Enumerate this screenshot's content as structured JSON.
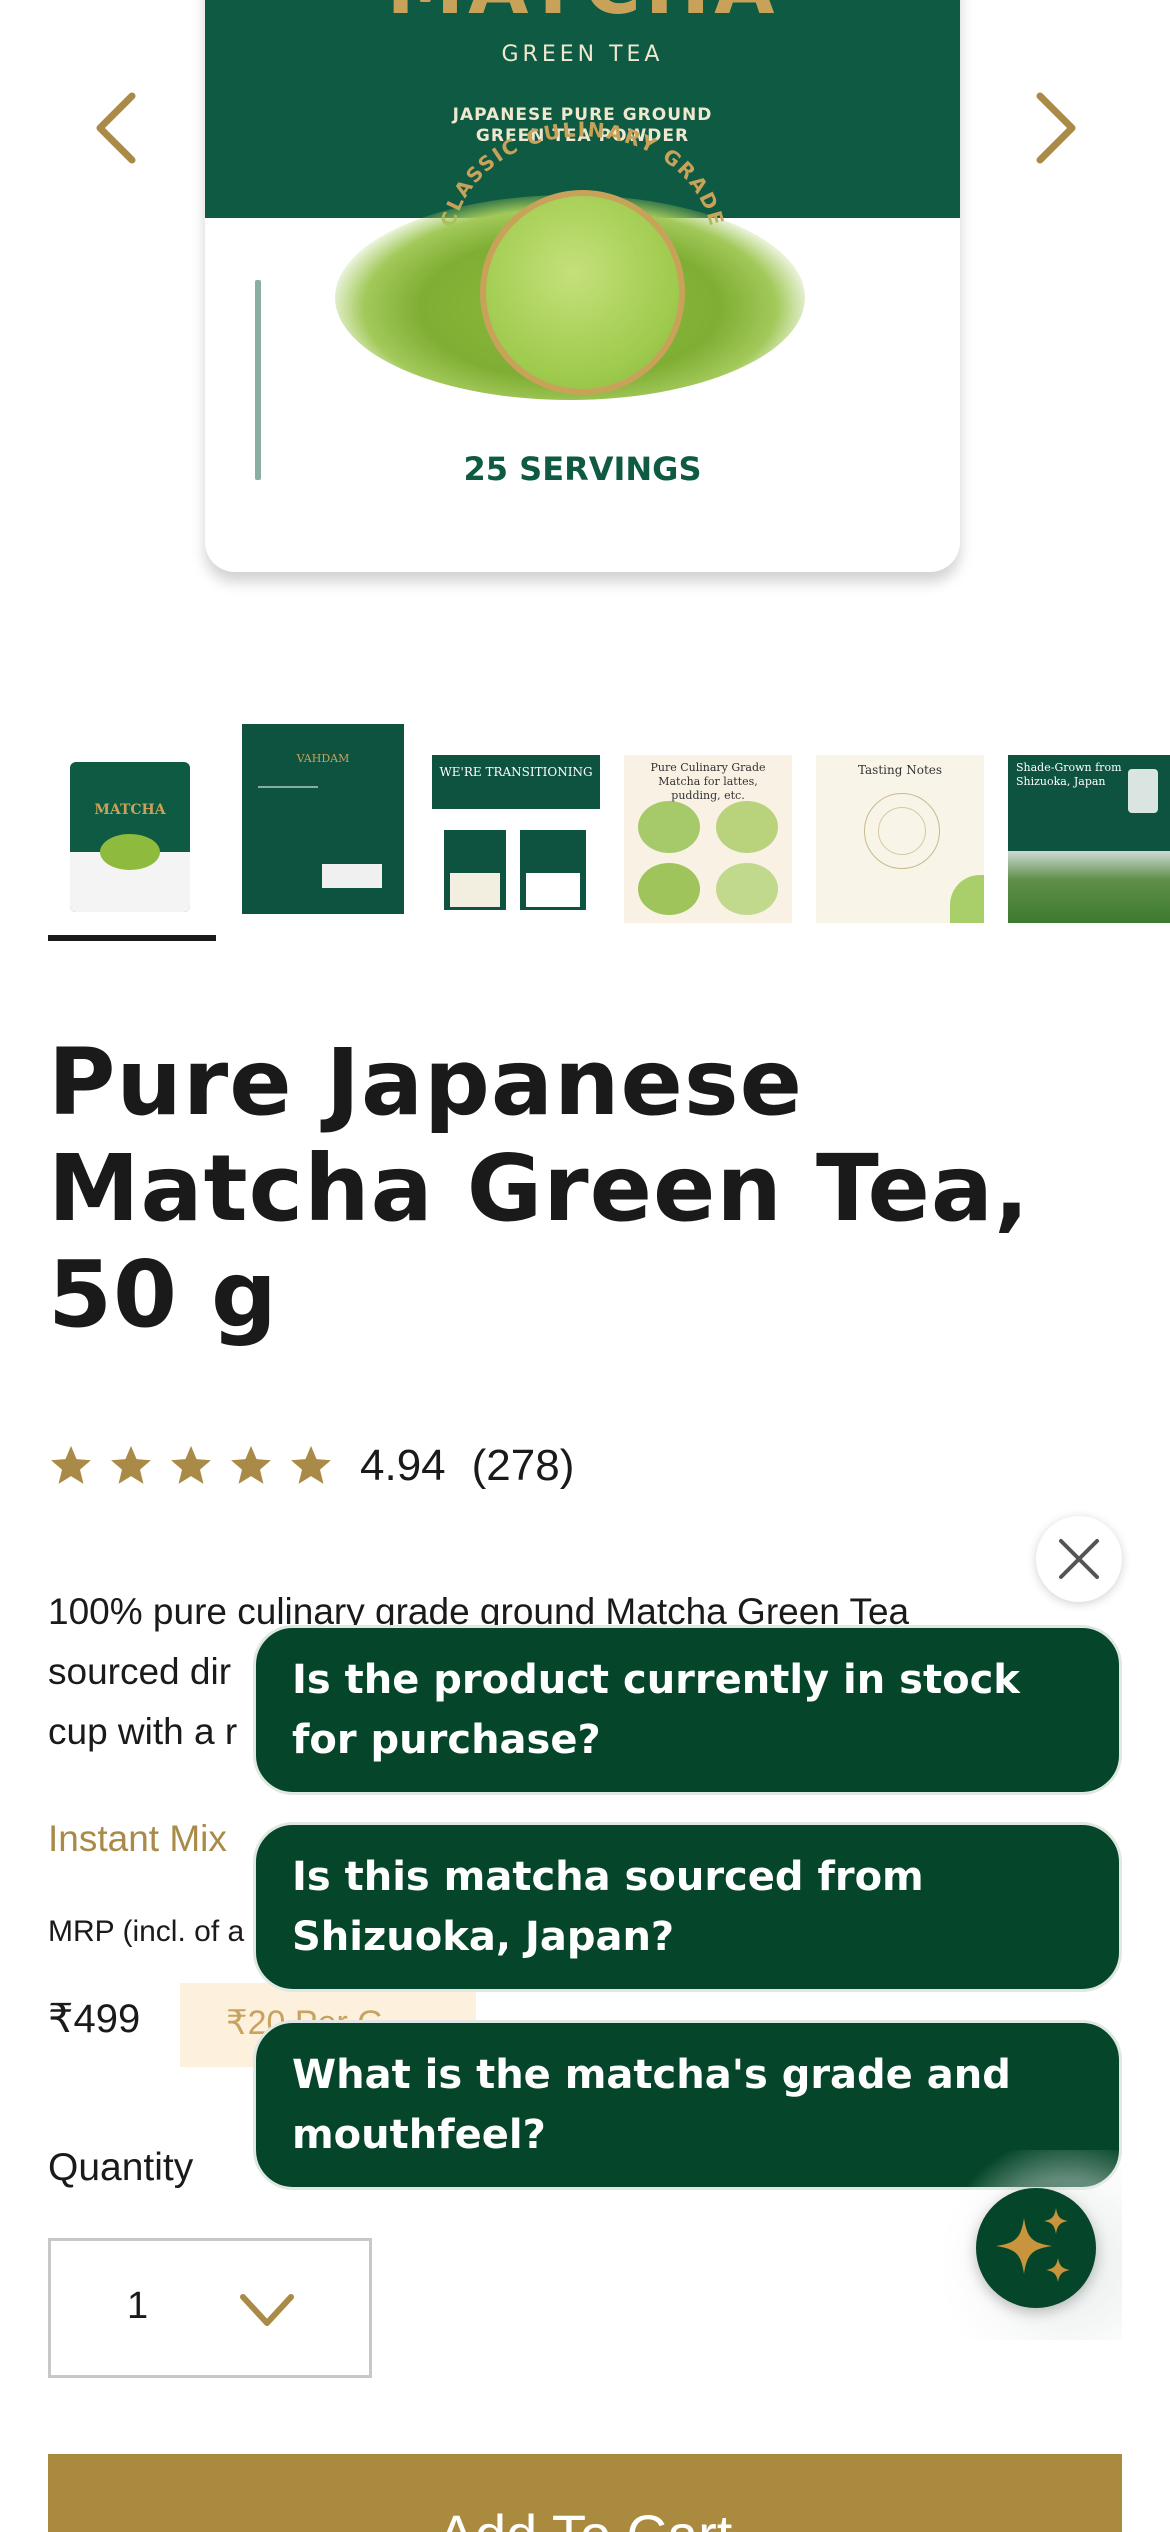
{
  "hero": {
    "bag_title": "MATCHA",
    "bag_subtitle": "GREEN TEA",
    "bag_line1": "JAPANESE PURE GROUND",
    "bag_line2": "GREEN TEA POWDER",
    "bag_grade": "CLASSIC CULINARY GRADE",
    "bag_servings": "25 SERVINGS",
    "prev_icon": "chevron-left-icon",
    "next_icon": "chevron-right-icon"
  },
  "thumbnails": [
    {
      "label": "MATCHA"
    },
    {
      "label": "VAHDAM"
    },
    {
      "label": "WE'RE TRANSITIONING"
    },
    {
      "label": "Pure Culinary Grade Matcha for lattes, pudding, etc."
    },
    {
      "label": "Tasting Notes"
    },
    {
      "label": "Shade-Grown from Shizuoka, Japan"
    }
  ],
  "product": {
    "title": "Pure Japanese Matcha Green Tea, 50 g",
    "rating_value": "4.94",
    "rating_count": "(278)",
    "rating_stars": 5,
    "description_line1": "100% pure culinary grade ground Matcha Green Tea",
    "description_line2": "sourced dir",
    "description_line3": "cup with a r",
    "instant_mix": "Instant Mix",
    "mrp": "MRP (incl. of a",
    "price": "₹499",
    "per_gram": "₹20 Per G",
    "quantity_label": "Quantity",
    "quantity_value": "1",
    "add_to_cart": "Add To Cart"
  },
  "assistant": {
    "questions": [
      "Is the product currently in stock for purchase?",
      "Is this matcha sourced from Shizuoka, Japan?",
      "What is the matcha's grade and mouthfeel?"
    ],
    "close_icon": "close-icon",
    "fab_icon": "sparkle-icon"
  },
  "colors": {
    "brand_gold": "#a98a3f",
    "brand_green": "#05462a",
    "price_badge_bg": "#fdf1de"
  }
}
